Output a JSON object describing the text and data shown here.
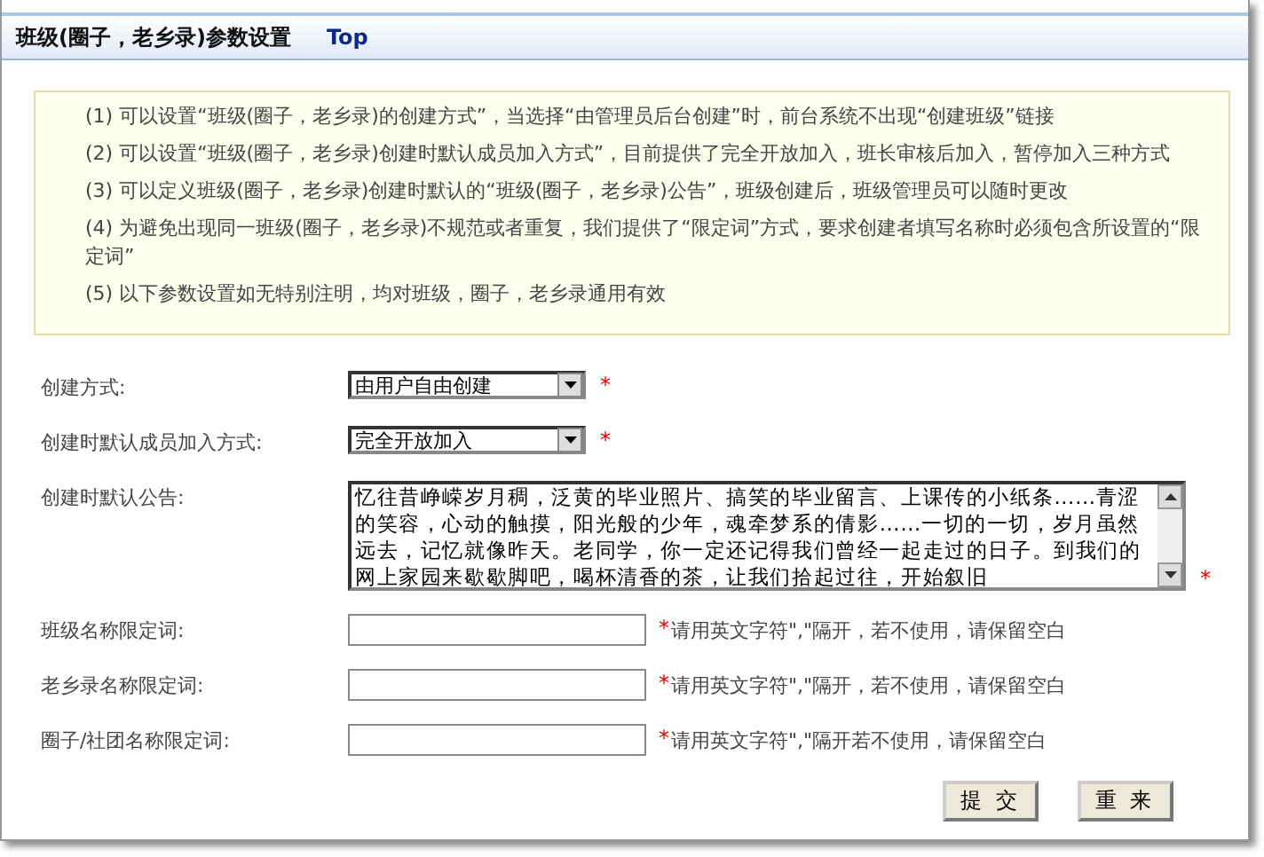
{
  "header": {
    "title": "班级(圈子，老乡录)参数设置",
    "link": "Top"
  },
  "notes": [
    "(1) 可以设置“班级(圈子，老乡录)的创建方式”，当选择“由管理员后台创建”时，前台系统不出现“创建班级”链接",
    "(2) 可以设置“班级(圈子，老乡录)创建时默认成员加入方式”，目前提供了完全开放加入，班长审核后加入，暂停加入三种方式",
    "(3) 可以定义班级(圈子，老乡录)创建时默认的“班级(圈子，老乡录)公告”，班级创建后，班级管理员可以随时更改",
    "(4) 为避免出现同一班级(圈子，老乡录)不规范或者重复，我们提供了“限定词”方式，要求创建者填写名称时必须包含所设置的“限定词”",
    "(5) 以下参数设置如无特别注明，均对班级，圈子，老乡录通用有效"
  ],
  "form": [
    {
      "kind": "select",
      "label": "创建方式:",
      "value": "由用户自由创建",
      "required_mark": "*"
    },
    {
      "kind": "select",
      "label": "创建时默认成员加入方式:",
      "value": "完全开放加入",
      "required_mark": "*"
    },
    {
      "kind": "textarea",
      "label": "创建时默认公告:",
      "value": "忆往昔峥嵘岁月稠，泛黄的毕业照片、搞笑的毕业留言、上课传的小纸条……青涩的笑容，心动的触摸，阳光般的少年，魂牵梦系的倩影……一切的一切，岁月虽然远去，记忆就像昨天。老同学，你一定还记得我们曾经一起走过的日子。到我们的网上家园来歇歇脚吧，喝杯清香的茶，让我们拾起过往，开始叙旧",
      "required_mark": "*"
    },
    {
      "kind": "text",
      "label": "班级名称限定词:",
      "required_mark": "*",
      "hint": "请用英文字符\",\"隔开，若不使用，请保留空白"
    },
    {
      "kind": "text",
      "label": "老乡录名称限定词:",
      "required_mark": "*",
      "hint": "请用英文字符\",\"隔开，若不使用，请保留空白"
    },
    {
      "kind": "text",
      "label": "圈子/社团名称限定词:",
      "required_mark": "*",
      "hint": "请用英文字符\",\"隔开若不使用，请保留空白"
    }
  ],
  "buttons": [
    "提 交",
    "重 来"
  ]
}
